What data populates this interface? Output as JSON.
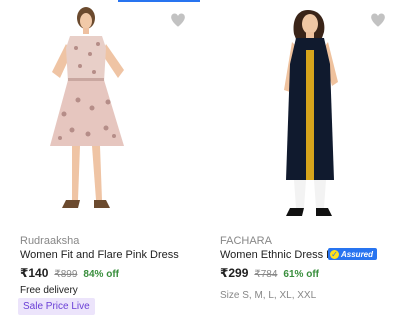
{
  "colors": {
    "accent": "#2874f0",
    "discount": "#388e3c",
    "muted": "#878787",
    "tag_bg": "#ece4fb",
    "tag_text": "#6a3fd6",
    "assured_bg": "#2874f0"
  },
  "products": [
    {
      "brand": "Rudraaksha",
      "title": "Women Fit and Flare Pink Dress",
      "price": "₹140",
      "mrp": "₹899",
      "discount": "84% off",
      "delivery": "Free delivery",
      "tag": "Sale Price Live",
      "wishlist_icon": "heart-icon",
      "image_label": "dress-image"
    },
    {
      "brand": "FACHARA",
      "title": "Women Ethnic Dress Bl…",
      "price": "₹299",
      "mrp": "₹784",
      "discount": "61% off",
      "sizes": "Size S, M, L, XL, XXL",
      "assured_badge": "Assured",
      "wishlist_icon": "heart-icon",
      "image_label": "dress-image"
    }
  ]
}
